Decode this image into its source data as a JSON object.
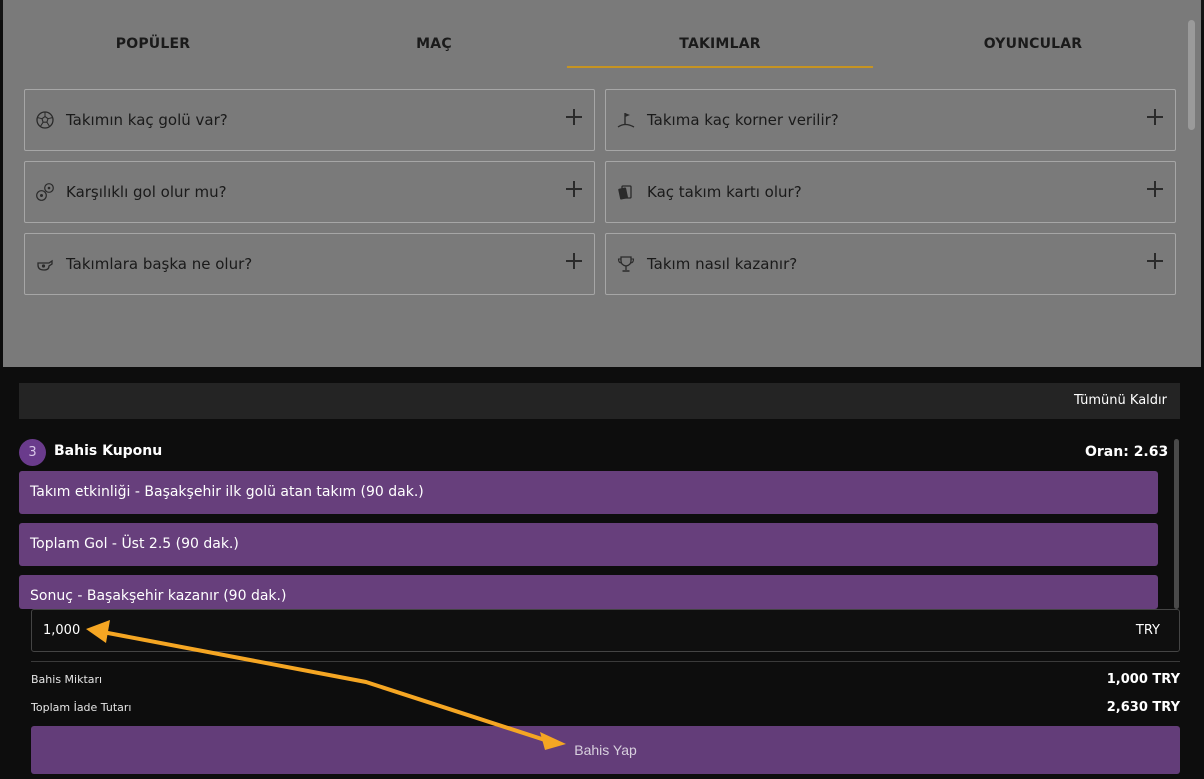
{
  "header": {
    "close_symbol": "✕"
  },
  "tabs": [
    {
      "label": "POPÜLER",
      "active": false
    },
    {
      "label": "MAÇ",
      "active": false
    },
    {
      "label": "TAKIMLAR",
      "active": true
    },
    {
      "label": "OYUNCULAR",
      "active": false
    }
  ],
  "markets": [
    {
      "label": "Takımın kaç golü var?",
      "icon": "football-icon"
    },
    {
      "label": "Takıma kaç korner verilir?",
      "icon": "corner-flag-icon"
    },
    {
      "label": "Karşılıklı gol olur mu?",
      "icon": "two-balls-icon"
    },
    {
      "label": "Kaç takım kartı olur?",
      "icon": "cards-icon"
    },
    {
      "label": "Takımlara başka ne olur?",
      "icon": "whistle-icon"
    },
    {
      "label": "Takım nasıl kazanır?",
      "icon": "trophy-icon"
    }
  ],
  "slip": {
    "remove_all": "Tümünü Kaldır",
    "count": "3",
    "title": "Bahis Kuponu",
    "odds_label": "Oran: 2.63",
    "selections": [
      "Takım etkinliği - Başakşehir ilk golü atan takım (90 dak.)",
      "Toplam Gol - Üst 2.5 (90 dak.)",
      "Sonuç - Başakşehir kazanır (90 dak.)"
    ],
    "stake_value": "1,000",
    "currency": "TRY",
    "stake_label": "Bahis Miktarı",
    "stake_amount": "1,000 TRY",
    "return_label": "Toplam İade Tutarı",
    "return_amount": "2,630 TRY",
    "place_bet": "Bahis Yap"
  },
  "colors": {
    "accent_gold": "#c69422",
    "selection_purple": "#673f7c",
    "button_purple": "#633d79",
    "arrow_orange": "#f5a623"
  }
}
